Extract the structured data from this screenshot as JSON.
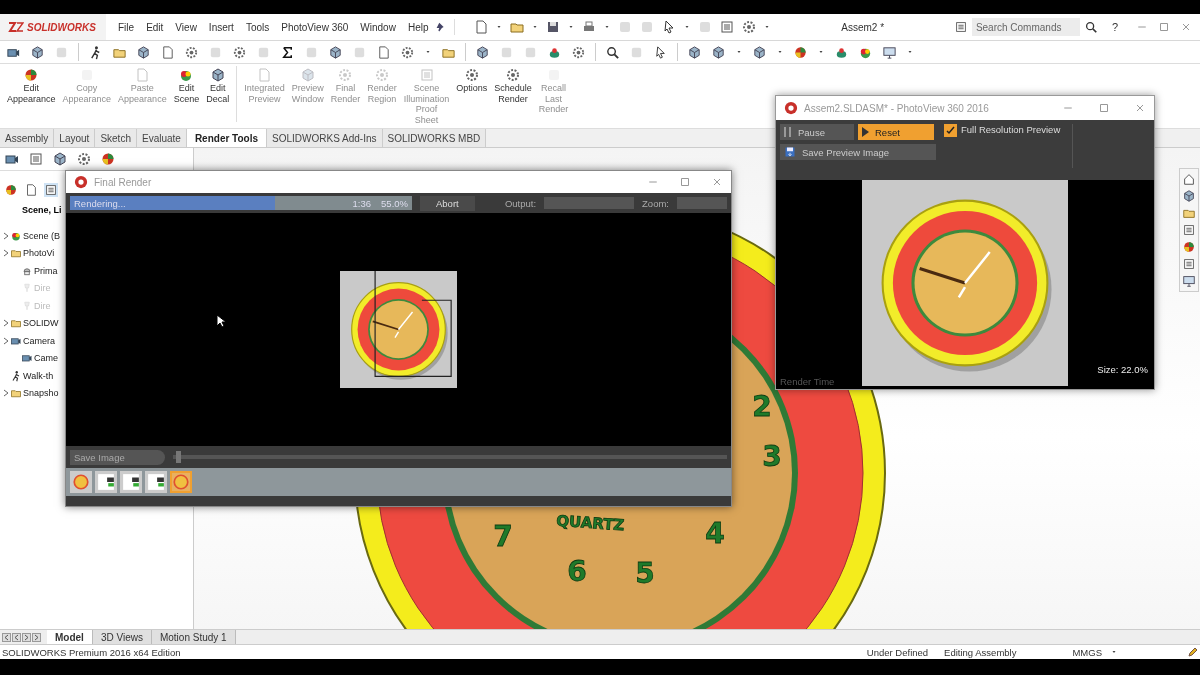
{
  "app": {
    "logo": "SOLIDWORKS",
    "menu": [
      "File",
      "Edit",
      "View",
      "Insert",
      "Tools",
      "PhotoView 360",
      "Window",
      "Help"
    ],
    "document_title": "Assem2 *",
    "search": {
      "placeholder": "Search Commands"
    },
    "help": "?"
  },
  "ribbon": [
    {
      "label": "Edit Appearance",
      "disabled": false
    },
    {
      "label": "Copy Appearance",
      "disabled": true
    },
    {
      "label": "Paste Appearance",
      "disabled": true
    },
    {
      "label": "Edit Scene",
      "disabled": false
    },
    {
      "label": "Edit Decal",
      "disabled": false
    },
    {
      "label": "Integrated Preview",
      "disabled": true
    },
    {
      "label": "Preview Window",
      "disabled": true
    },
    {
      "label": "Final Render",
      "disabled": true
    },
    {
      "label": "Render Region",
      "disabled": true
    },
    {
      "label": "Scene Illumination Proof Sheet",
      "disabled": true
    },
    {
      "label": "Options",
      "disabled": false
    },
    {
      "label": "Schedule Render",
      "disabled": false
    },
    {
      "label": "Recall Last Render",
      "disabled": true
    }
  ],
  "tabs": [
    {
      "label": "Assembly",
      "selected": false
    },
    {
      "label": "Layout",
      "selected": false
    },
    {
      "label": "Sketch",
      "selected": false
    },
    {
      "label": "Evaluate",
      "selected": false
    },
    {
      "label": "Render Tools",
      "selected": true
    },
    {
      "label": "SOLIDWORKS Add-Ins",
      "selected": false
    },
    {
      "label": "SOLIDWORKS MBD",
      "selected": false
    }
  ],
  "feature_tree": {
    "header": "Scene, Li",
    "items": [
      {
        "label": "Scene (B",
        "kind": "scene",
        "disabled": false
      },
      {
        "label": "PhotoVi",
        "kind": "folder",
        "disabled": false,
        "children": [
          {
            "label": "Prima",
            "kind": "light",
            "disabled": false
          },
          {
            "label": "Dire",
            "kind": "lamp",
            "disabled": true
          },
          {
            "label": "Dire",
            "kind": "lamp",
            "disabled": true
          }
        ]
      },
      {
        "label": "SOLIDW",
        "kind": "folder",
        "disabled": false
      },
      {
        "label": "Camera",
        "kind": "camera",
        "disabled": false,
        "children": [
          {
            "label": "Came",
            "kind": "camera",
            "disabled": false
          }
        ]
      },
      {
        "label": "Walk-th",
        "kind": "walk",
        "disabled": false
      },
      {
        "label": "Snapsho",
        "kind": "folder",
        "disabled": false
      }
    ]
  },
  "model_labels": [
    {
      "text": "2"
    },
    {
      "text": "3"
    },
    {
      "text": "4"
    },
    {
      "text": "5"
    },
    {
      "text": "6"
    },
    {
      "text": "7"
    },
    {
      "text": "QUARTZ"
    }
  ],
  "final_render": {
    "title": "Final Render",
    "status": "Rendering...",
    "level": 0.6,
    "time": "1:36",
    "percent": "55.0%",
    "abort": "Abort",
    "output_label": "Output:",
    "zoom_label": "Zoom:",
    "save_image": "Save Image",
    "slider": {
      "level": 0.01
    },
    "thumbnails": [
      {
        "kind": "clock",
        "selected": false
      },
      {
        "kind": "blank",
        "selected": false
      },
      {
        "kind": "blank",
        "selected": false
      },
      {
        "kind": "blank",
        "selected": false
      },
      {
        "kind": "clock",
        "selected": true
      }
    ]
  },
  "preview": {
    "title": "Assem2.SLDASM* - PhotoView 360 2016",
    "pause": "Pause",
    "reset": "Reset",
    "full_resolution": {
      "label": "Full Resolution Preview",
      "checked": true
    },
    "save": "Save Preview Image",
    "size": "Size: 22.0%",
    "render_time": "Render Time"
  },
  "bottom_tabs": [
    {
      "label": "Model",
      "selected": true
    },
    {
      "label": "3D Views",
      "selected": false
    },
    {
      "label": "Motion Study 1",
      "selected": false
    }
  ],
  "status_bar": {
    "edition": "SOLIDWORKS Premium 2016 x64 Edition",
    "state": "Under Defined",
    "mode": "Editing Assembly",
    "units": "MMGS"
  }
}
